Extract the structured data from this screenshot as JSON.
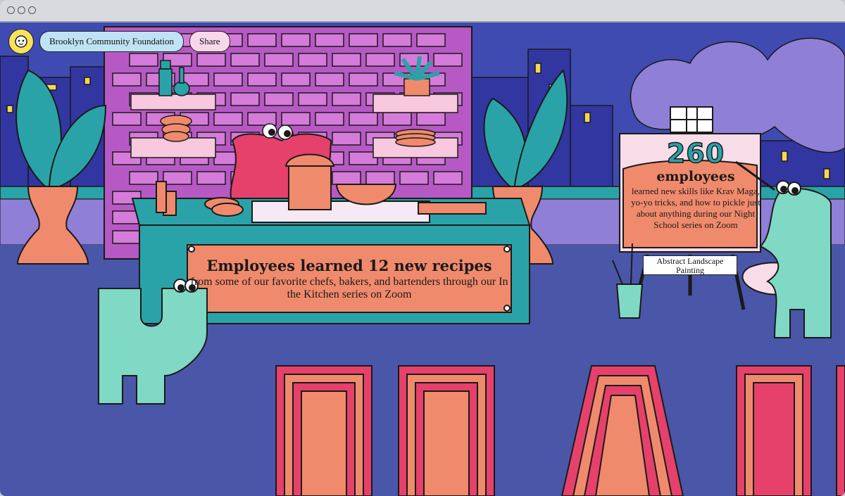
{
  "nav": {
    "logo_icon": "chimp-head-icon",
    "organization": "Brooklyn Community Foundation",
    "share_label": "Share"
  },
  "kitchen": {
    "title": "Employees learned 12 new recipes",
    "body": "from some of our favorite chefs, bakers, and bartenders through our In the Kitchen series on Zoom"
  },
  "night_school": {
    "count": "260",
    "unit": "employees",
    "body": "learned new skills like Krav Maga, yo-yo tricks, and how to pickle just about anything during our Night School series on Zoom",
    "plaque": "Abstract Landscape Painting"
  },
  "colors": {
    "background": "#4a56a8",
    "brick": "#b659c4",
    "counter": "#2aa3a8",
    "salmon": "#f08a6c",
    "mint": "#7fd9c4",
    "sky_purple": "#8f7fd6",
    "letter_red": "#e5416a"
  }
}
